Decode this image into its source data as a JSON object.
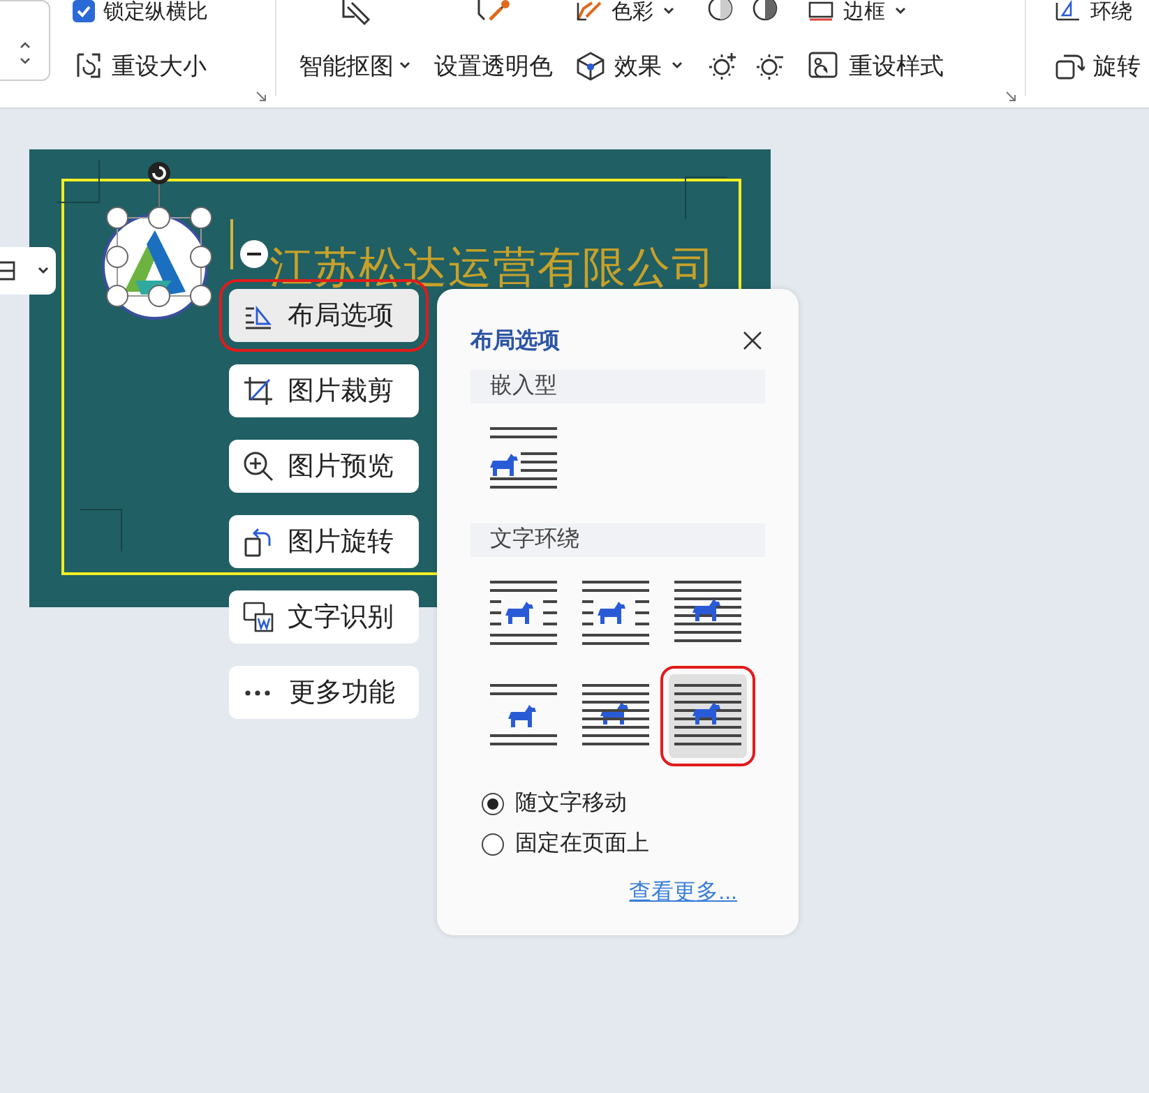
{
  "ribbon": {
    "size_group": {
      "lock_aspect": {
        "label": "锁定纵横比",
        "checked": true
      },
      "reset_size": "重设大小"
    },
    "picture_tools": {
      "smart_cutout": "智能抠图",
      "transparent_color": "设置透明色",
      "color_adjust": "色彩",
      "effects": "效果",
      "border": "边框",
      "reset_style": "重设样式"
    },
    "arrange": {
      "wrap": "环绕",
      "rotate": "旋转"
    }
  },
  "document": {
    "company_name": "江苏松达运营有限公司"
  },
  "quick_menu": [
    {
      "label": "布局选项",
      "kind": "layout",
      "selected": true
    },
    {
      "label": "图片裁剪",
      "kind": "crop",
      "selected": false
    },
    {
      "label": "图片预览",
      "kind": "zoom",
      "selected": false
    },
    {
      "label": "图片旋转",
      "kind": "rotate",
      "selected": false
    },
    {
      "label": "文字识别",
      "kind": "ocr",
      "selected": false
    },
    {
      "label": "更多功能",
      "kind": "more",
      "selected": false
    }
  ],
  "layout_panel": {
    "title": "布局选项",
    "sections": [
      {
        "title": "嵌入型",
        "options": [
          {
            "kind": "inline",
            "selected": false
          }
        ]
      },
      {
        "title": "文字环绕",
        "options": [
          {
            "kind": "square",
            "selected": false
          },
          {
            "kind": "tight",
            "selected": false
          },
          {
            "kind": "through",
            "selected": false
          },
          {
            "kind": "top_bottom",
            "selected": false
          },
          {
            "kind": "behind",
            "selected": false
          },
          {
            "kind": "front",
            "selected": true
          }
        ]
      }
    ],
    "position": [
      {
        "label": "随文字移动",
        "selected": true
      },
      {
        "label": "固定在页面上",
        "selected": false
      }
    ],
    "more_link": "查看更多..."
  }
}
